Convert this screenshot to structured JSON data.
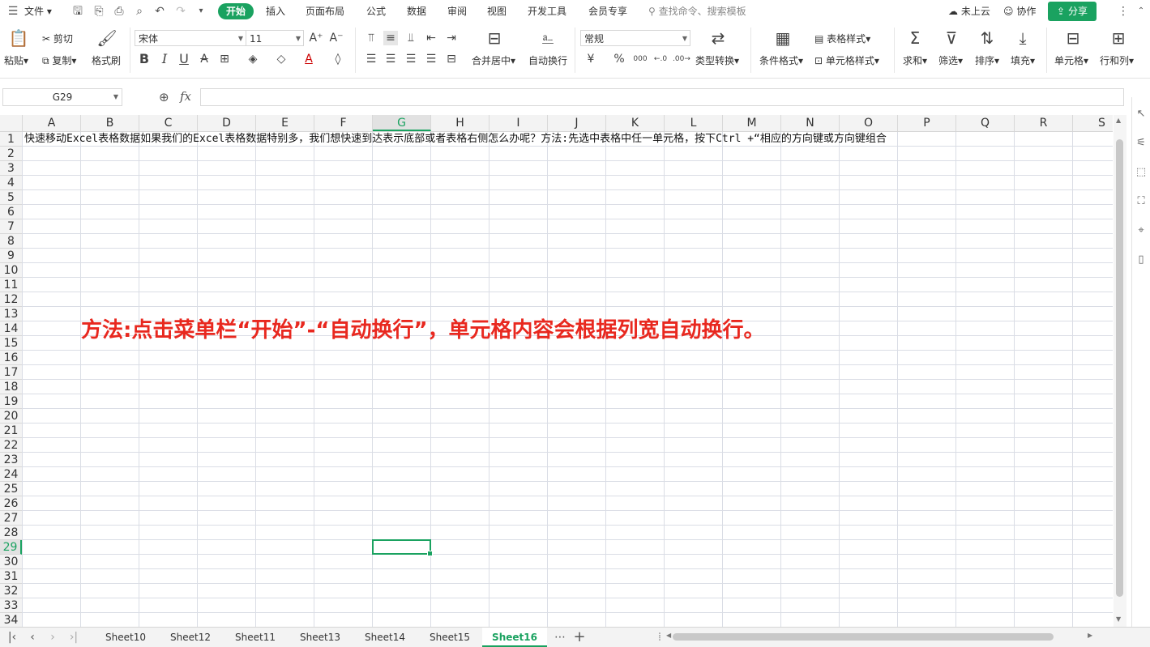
{
  "menubar": {
    "file_label": "文件",
    "tabs": [
      "开始",
      "插入",
      "页面布局",
      "公式",
      "数据",
      "审阅",
      "视图",
      "开发工具",
      "会员专享"
    ],
    "search_placeholder": "查找命令、搜索模板",
    "cloud_label": "未上云",
    "collab_label": "协作",
    "share_label": "分享"
  },
  "ribbon": {
    "paste": "粘贴",
    "cut": "剪切",
    "copy": "复制",
    "format_painter": "格式刷",
    "font_name": "宋体",
    "font_size": "11",
    "merge_center": "合并居中",
    "wrap_text": "自动换行",
    "number_format": "常规",
    "type_convert": "类型转换",
    "cond_format": "条件格式",
    "table_style": "表格样式",
    "cell_style": "单元格样式",
    "sum": "求和",
    "filter": "筛选",
    "sort": "排序",
    "fill": "填充",
    "cell": "单元格",
    "row_col": "行和列",
    "bold": "B",
    "italic": "I",
    "underline": "U",
    "currency": "¥",
    "percent": "%",
    "thousands": "000"
  },
  "formula_bar": {
    "name_box": "G29",
    "fx": "fx",
    "value": ""
  },
  "columns": [
    "A",
    "B",
    "C",
    "D",
    "E",
    "F",
    "G",
    "H",
    "I",
    "J",
    "K",
    "L",
    "M",
    "N",
    "O",
    "P",
    "Q",
    "R",
    "S"
  ],
  "active_column": "G",
  "rows": [
    "1",
    "2",
    "3",
    "4",
    "5",
    "6",
    "7",
    "8",
    "9",
    "10",
    "11",
    "12",
    "13",
    "14",
    "15",
    "16",
    "17",
    "18",
    "19",
    "20",
    "21",
    "22",
    "23",
    "24",
    "25",
    "26",
    "27",
    "28",
    "29",
    "30",
    "31",
    "32",
    "33",
    "34"
  ],
  "active_row": "29",
  "cell_a1": "快速移动Excel表格数据如果我们的Excel表格数据特别多，我们想快速到达表示底部或者表格右侧怎么办呢？方法:先选中表格中任一单元格，按下Ctrl +“相应的方向键或方向键组合",
  "annotation": "方法:点击菜单栏“开始”-“自动换行”，单元格内容会根据列宽自动换行。",
  "sheets": [
    "Sheet10",
    "Sheet12",
    "Sheet11",
    "Sheet13",
    "Sheet14",
    "Sheet15",
    "Sheet16"
  ],
  "active_sheet": "Sheet16",
  "colors": {
    "accent": "#1aa260",
    "annotation": "#e8281f"
  }
}
